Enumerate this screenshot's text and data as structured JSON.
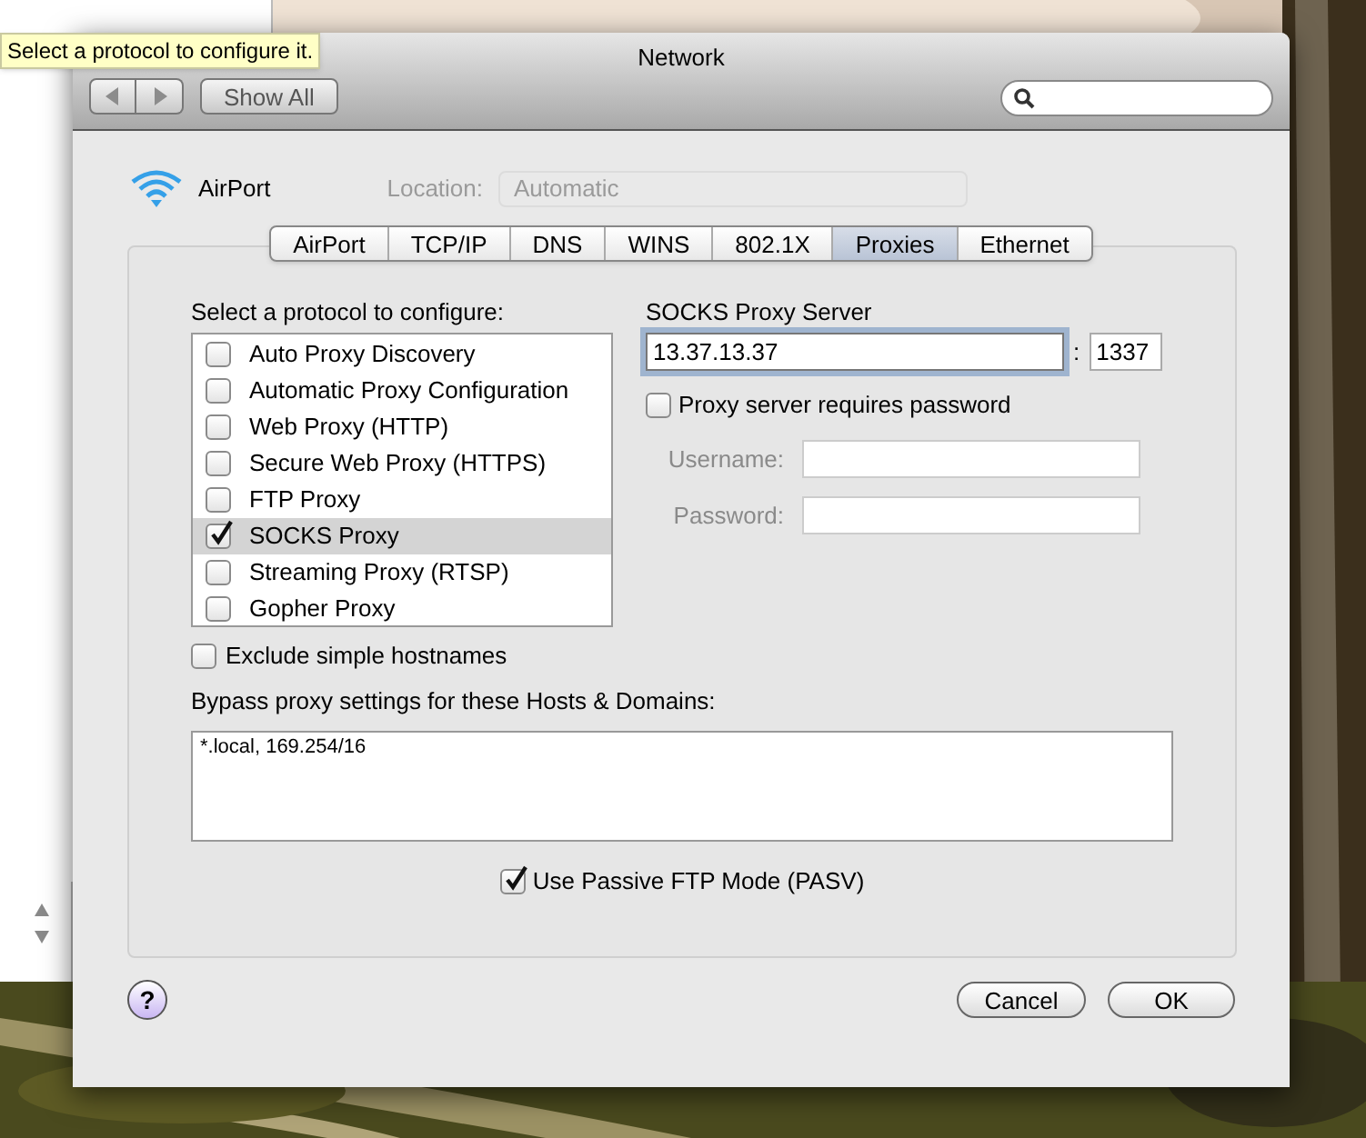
{
  "tooltip": "Select a protocol to configure it.",
  "window": {
    "title": "Network"
  },
  "toolbar": {
    "show_all": "Show All"
  },
  "service": {
    "name": "AirPort"
  },
  "location": {
    "label": "Location:",
    "value": "Automatic"
  },
  "tabs": [
    {
      "label": "AirPort",
      "selected": false
    },
    {
      "label": "TCP/IP",
      "selected": false
    },
    {
      "label": "DNS",
      "selected": false
    },
    {
      "label": "WINS",
      "selected": false
    },
    {
      "label": "802.1X",
      "selected": false
    },
    {
      "label": "Proxies",
      "selected": true
    },
    {
      "label": "Ethernet",
      "selected": false
    }
  ],
  "protocols": {
    "label": "Select a protocol to configure:",
    "items": [
      {
        "label": "Auto Proxy Discovery",
        "checked": false,
        "selected": false
      },
      {
        "label": "Automatic Proxy Configuration",
        "checked": false,
        "selected": false
      },
      {
        "label": "Web Proxy (HTTP)",
        "checked": false,
        "selected": false
      },
      {
        "label": "Secure Web Proxy (HTTPS)",
        "checked": false,
        "selected": false
      },
      {
        "label": "FTP Proxy",
        "checked": false,
        "selected": false
      },
      {
        "label": "SOCKS Proxy",
        "checked": true,
        "selected": true
      },
      {
        "label": "Streaming Proxy (RTSP)",
        "checked": false,
        "selected": false
      },
      {
        "label": "Gopher Proxy",
        "checked": false,
        "selected": false
      }
    ]
  },
  "server": {
    "label": "SOCKS Proxy Server",
    "host": "13.37.13.37",
    "separator": ":",
    "port": "1337"
  },
  "requires_password": {
    "label": "Proxy server requires password",
    "checked": false
  },
  "credentials": {
    "disabled": true,
    "fields": [
      {
        "label": "Username:"
      },
      {
        "label": "Password:"
      }
    ]
  },
  "exclude_simple": {
    "label": "Exclude simple hostnames",
    "checked": false
  },
  "bypass": {
    "label": "Bypass proxy settings for these Hosts & Domains:",
    "value": "*.local, 169.254/16"
  },
  "passive_ftp": {
    "label": "Use Passive FTP Mode (PASV)",
    "checked": true
  },
  "help": "?",
  "buttons": {
    "cancel": "Cancel",
    "ok": "OK"
  }
}
